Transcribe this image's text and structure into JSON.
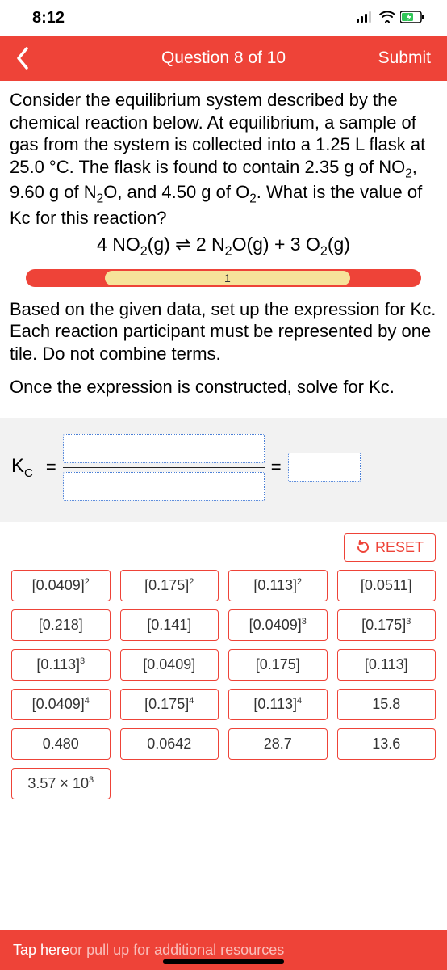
{
  "status": {
    "time": "8:12"
  },
  "nav": {
    "title": "Question 8 of 10",
    "submit": "Submit"
  },
  "prompt": {
    "main_html": "Consider the equilibrium system described by the chemical reaction below. At equilibrium, a sample of gas from the system is collected into a 1.25 L flask at 25.0 °C. The flask is found to contain 2.35 g of NO<sub>2</sub>, 9.60 g of N<sub>2</sub>O, and 4.50 g of O<sub>2</sub>. What is the value of Kc for this reaction?",
    "equation_html": "4 NO<sub>2</sub>(g)  ⇌ 2 N<sub>2</sub>O(g) + 3 O<sub>2</sub>(g)",
    "sub1": "Based on the given data, set up the expression for Kc. Each reaction participant must be represented by one tile. Do not combine terms.",
    "sub2": "Once the expression is constructed, solve for Kc."
  },
  "progress": {
    "step": "1"
  },
  "expr": {
    "kc_html": "K<sub>C</sub>",
    "eq": "="
  },
  "reset": {
    "label": "RESET"
  },
  "tiles": [
    "[0.0409]<sup>2</sup>",
    "[0.175]<sup>2</sup>",
    "[0.113]<sup>2</sup>",
    "[0.0511]",
    "[0.218]",
    "[0.141]",
    "[0.0409]<sup>3</sup>",
    "[0.175]<sup>3</sup>",
    "[0.113]<sup>3</sup>",
    "[0.0409]",
    "[0.175]",
    "[0.113]",
    "[0.0409]<sup>4</sup>",
    "[0.175]<sup>4</sup>",
    "[0.113]<sup>4</sup>",
    "15.8",
    "0.480",
    "0.0642",
    "28.7",
    "13.6",
    "3.57 × 10<sup>3</sup>"
  ],
  "footer": {
    "tap": "Tap here",
    "rest": " or pull up for additional resources"
  }
}
